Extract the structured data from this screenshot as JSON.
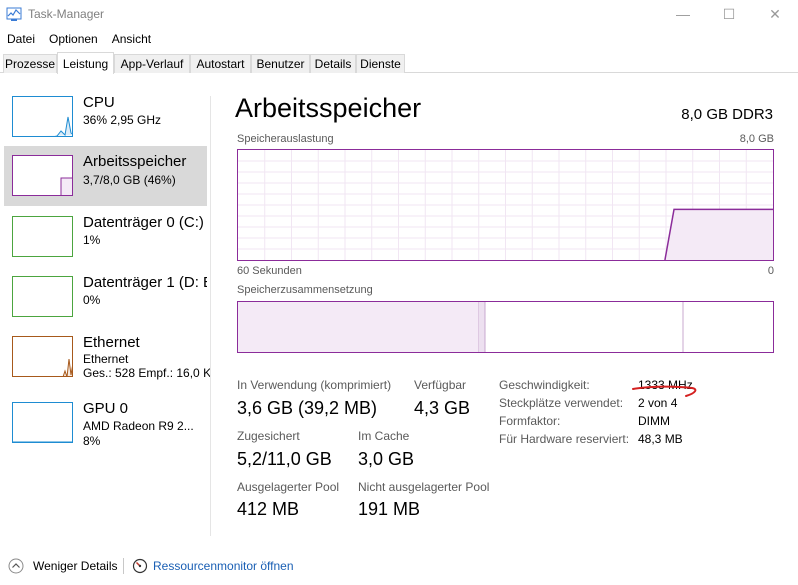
{
  "window": {
    "title": "Task-Manager",
    "min_glyph": "—",
    "max_glyph": "☐",
    "close_glyph": "✕"
  },
  "menu": [
    "Datei",
    "Optionen",
    "Ansicht"
  ],
  "tabs": [
    "Prozesse",
    "Leistung",
    "App-Verlauf",
    "Autostart",
    "Benutzer",
    "Details",
    "Dienste"
  ],
  "active_tab": "Leistung",
  "sidebar": {
    "items": [
      {
        "name": "CPU",
        "sub": "36% 2,95 GHz",
        "color": "#1e8cd2"
      },
      {
        "name": "Arbeitsspeicher",
        "sub": "3,7/8,0 GB (46%)",
        "color": "#8b2c9a"
      },
      {
        "name": "Datenträger 0 (C:)",
        "sub": "1%",
        "color": "#4ca53f"
      },
      {
        "name": "Datenträger 1 (D: E",
        "sub": "0%",
        "color": "#4ca53f"
      },
      {
        "name": "Ethernet",
        "sub": "Ethernet",
        "sub2": "Ges.: 528 Empf.: 16,0 KB",
        "color": "#a7591b"
      },
      {
        "name": "GPU 0",
        "sub": "AMD Radeon R9 2...",
        "sub2": "8%",
        "color": "#1e8cd2"
      }
    ]
  },
  "main": {
    "title": "Arbeitsspeicher",
    "spec": "8,0 GB DDR3",
    "graph1_label": "Speicherauslastung",
    "graph1_max": "8,0 GB",
    "graph1_xleft": "60 Sekunden",
    "graph1_xright": "0",
    "graph2_label": "Speicherzusammensetzung",
    "in_use_label": "In Verwendung (komprimiert)",
    "in_use_value": "3,6 GB (39,2 MB)",
    "available_label": "Verfügbar",
    "available_value": "4,3 GB",
    "committed_label": "Zugesichert",
    "committed_value": "5,2/11,0 GB",
    "cached_label": "Im Cache",
    "cached_value": "3,0 GB",
    "paged_label": "Ausgelagerter Pool",
    "paged_value": "412 MB",
    "nonpaged_label": "Nicht ausgelagerter Pool",
    "nonpaged_value": "191 MB",
    "speed_label": "Geschwindigkeit:",
    "speed_value": "1333 MHz",
    "slots_label": "Steckplätze verwendet:",
    "slots_value": "2 von 4",
    "form_label": "Formfaktor:",
    "form_value": "DIMM",
    "reserved_label": "Für Hardware reserviert:",
    "reserved_value": "48,3 MB",
    "usage_fraction": 0.46
  },
  "footer": {
    "fewer_details": "Weniger Details",
    "resource_monitor": "Ressourcenmonitor öffnen"
  },
  "colors": {
    "memory": "#8b2c9a",
    "annotation": "#d42020"
  }
}
